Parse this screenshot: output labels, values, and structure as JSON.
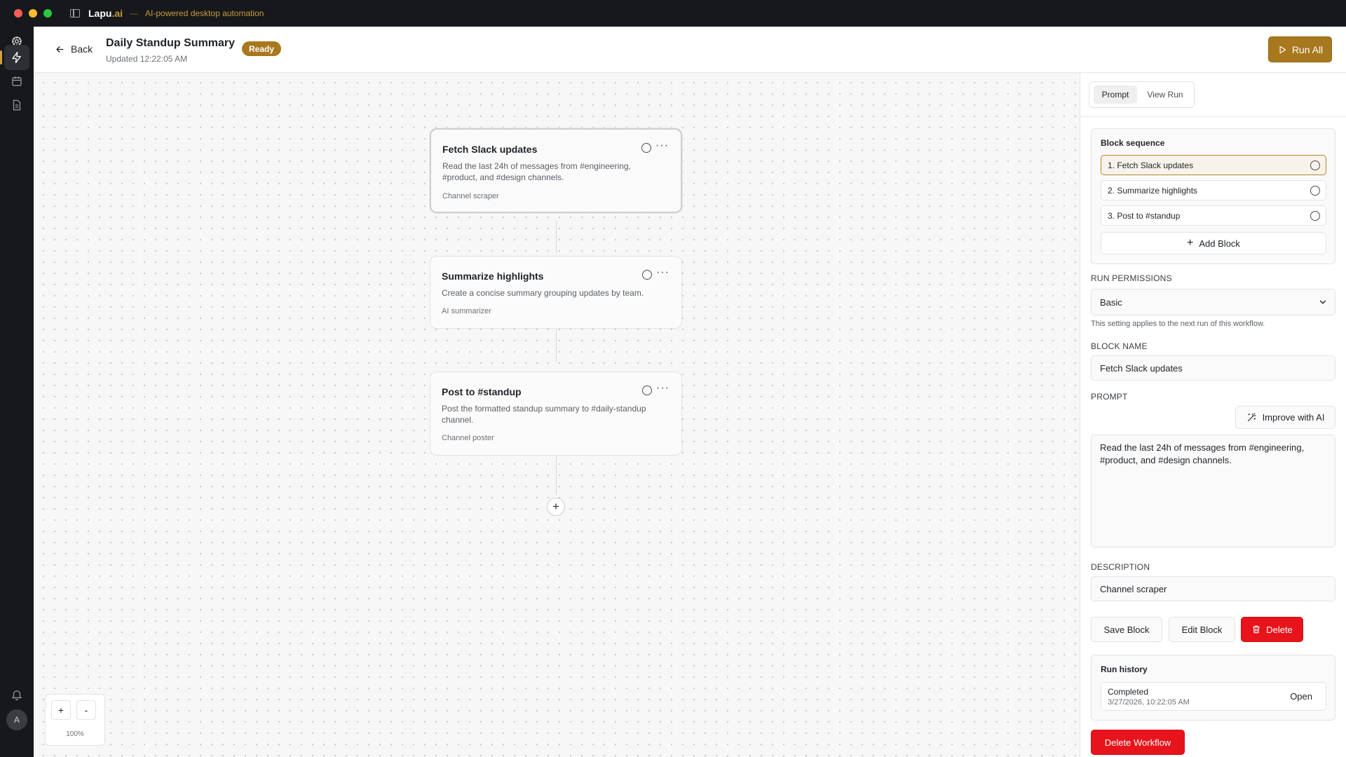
{
  "app": {
    "name": "Lapu",
    "name_suffix": ".ai",
    "separator": "—",
    "tagline": "AI-powered desktop automation"
  },
  "rail": {
    "items": [
      {
        "icon": "logo-icon"
      },
      {
        "icon": "lightning-icon",
        "active": true
      },
      {
        "icon": "calendar-icon"
      },
      {
        "icon": "document-icon"
      }
    ],
    "bottom": [
      {
        "icon": "bell-icon"
      },
      {
        "icon": "gear-icon"
      }
    ],
    "avatar_initial": "A"
  },
  "header": {
    "back_label": "Back",
    "title": "Daily Standup Summary",
    "updated": "Updated 12:22:05 AM",
    "status_badge": "Ready",
    "run_all_label": "Run All"
  },
  "canvas": {
    "nodes": [
      {
        "title": "Fetch Slack updates",
        "description": "Read the last 24h of messages from #engineering, #product, and #design channels.",
        "type": "Channel scraper",
        "selected": true
      },
      {
        "title": "Summarize highlights",
        "description": "Create a concise summary grouping updates by team.",
        "type": "AI summarizer",
        "selected": false
      },
      {
        "title": "Post to #standup",
        "description": "Post the formatted standup summary to #daily-standup channel.",
        "type": "Channel poster",
        "selected": false
      }
    ],
    "add_node_symbol": "+",
    "zoom": {
      "in_label": "+",
      "out_label": "-",
      "level": "100%"
    }
  },
  "panel": {
    "tabs": [
      {
        "label": "Prompt",
        "active": true
      },
      {
        "label": "View Run",
        "active": false
      }
    ],
    "sequence": {
      "title": "Block sequence",
      "items": [
        {
          "label": "1. Fetch Slack updates",
          "active": true
        },
        {
          "label": "2. Summarize highlights",
          "active": false
        },
        {
          "label": "3. Post to #standup",
          "active": false
        }
      ],
      "add_label": "Add Block"
    },
    "permissions": {
      "label": "RUN PERMISSIONS",
      "value": "Basic",
      "hint": "This setting applies to the next run of this workflow."
    },
    "block_name": {
      "label": "BLOCK NAME",
      "value": "Fetch Slack updates"
    },
    "prompt": {
      "label": "PROMPT",
      "improve_label": "Improve with AI",
      "value": "Read the last 24h of messages from #engineering, #product, and #design channels."
    },
    "description": {
      "label": "DESCRIPTION",
      "value": "Channel scraper"
    },
    "actions": {
      "save_label": "Save Block",
      "edit_label": "Edit Block",
      "delete_label": "Delete"
    },
    "history": {
      "title": "Run history",
      "runs": [
        {
          "status": "Completed",
          "time": "3/27/2026, 10:22:05 AM",
          "action": "Open"
        }
      ]
    },
    "delete_workflow_label": "Delete Workflow"
  },
  "colors": {
    "accent": "#a8781e",
    "danger": "#e8141b",
    "rail_bg": "#16181b"
  }
}
